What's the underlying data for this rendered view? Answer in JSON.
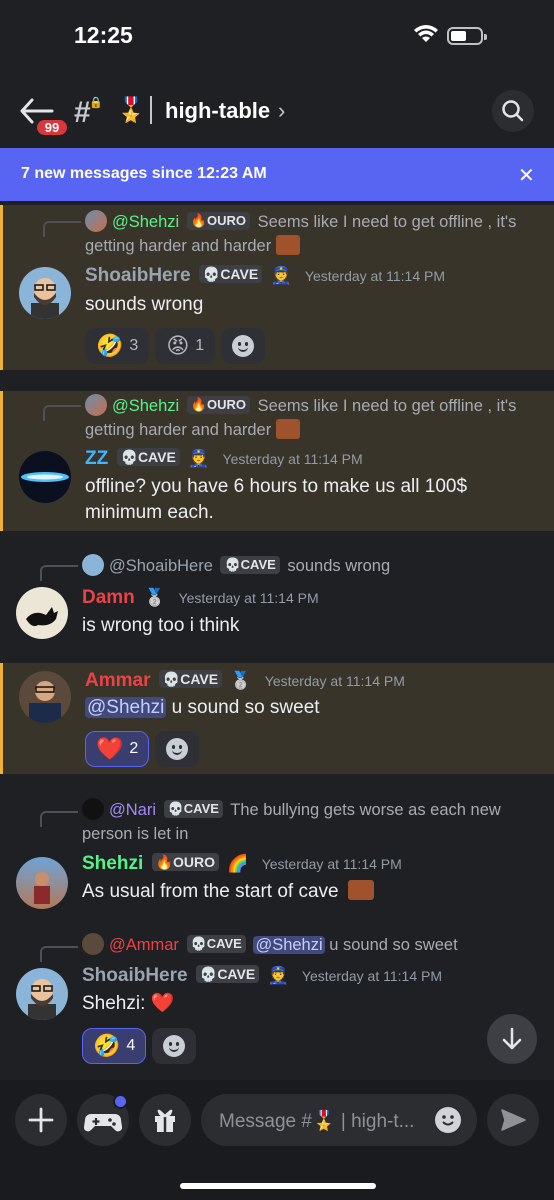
{
  "status": {
    "time": "12:25"
  },
  "header": {
    "unread_badge": "99",
    "hash": "#",
    "channel_emoji": "🎖️",
    "channel_name": "high-table",
    "chevron": "›"
  },
  "new_messages_bar": {
    "text": "7 new messages since 12:23 AM",
    "close": "✕"
  },
  "messages": [
    {
      "reply": {
        "name": "@Shehzi",
        "tag_emoji": "🔥",
        "tag": "OURO",
        "text": "Seems like I need to get offline , it's getting harder and harder"
      },
      "author": "ShoaibHere",
      "tag_emoji": "💀",
      "tag": "CAVE",
      "role_emoji": "👮",
      "timestamp": "Yesterday at 11:14 PM",
      "body": "sounds wrong",
      "reactions": [
        {
          "emoji": "🤣",
          "count": "3"
        },
        {
          "emoji": "😡",
          "count": "1"
        }
      ]
    },
    {
      "reply": {
        "name": "@Shehzi",
        "tag_emoji": "🔥",
        "tag": "OURO",
        "text": "Seems like I need to get offline , it's getting harder and harder"
      },
      "author": "ZZ",
      "tag_emoji": "💀",
      "tag": "CAVE",
      "role_emoji": "👮",
      "timestamp": "Yesterday at 11:14 PM",
      "body": "offline? you have 6 hours to make us all 100$ minimum each."
    },
    {
      "reply": {
        "name": "@ShoaibHere",
        "tag_emoji": "💀",
        "tag": "CAVE",
        "text": "sounds wrong"
      },
      "author": "Damn",
      "role_emoji": "🥈",
      "timestamp": "Yesterday at 11:14 PM",
      "body": "is wrong too i think"
    },
    {
      "author": "Ammar",
      "tag_emoji": "💀",
      "tag": "CAVE",
      "role_emoji": "🥈",
      "timestamp": "Yesterday at 11:14 PM",
      "mention": "@Shehzi",
      "body": "u sound so sweet",
      "reactions": [
        {
          "emoji": "❤️",
          "count": "2"
        }
      ]
    },
    {
      "reply": {
        "name": "@Nari",
        "tag_emoji": "💀",
        "tag": "CAVE",
        "text": "The bullying gets worse as each new person is let in"
      },
      "author": "Shehzi",
      "tag_emoji": "🔥",
      "tag": "OURO",
      "role_emoji": "🌈",
      "timestamp": "Yesterday at 11:14 PM",
      "body": "As usual from the start of cave"
    },
    {
      "reply": {
        "name": "@Ammar",
        "tag_emoji": "💀",
        "tag": "CAVE",
        "mention": "@Shehzi",
        "text": "u sound so sweet"
      },
      "author": "ShoaibHere",
      "tag_emoji": "💀",
      "tag": "CAVE",
      "role_emoji": "👮",
      "timestamp": "Yesterday at 11:14 PM",
      "body": "Shehzi: ❤️",
      "reactions": [
        {
          "emoji": "🤣",
          "count": "4"
        }
      ]
    }
  ],
  "composer": {
    "placeholder": "Message #🎖️ | high-t..."
  }
}
